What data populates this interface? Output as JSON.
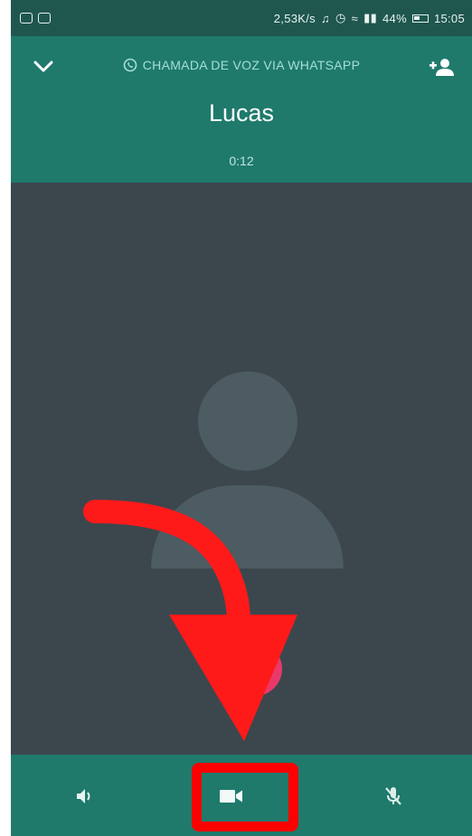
{
  "statusbar": {
    "speed": "2,53K/s",
    "battery": "44%",
    "time": "15:05"
  },
  "header": {
    "banner": "CHAMADA DE VOZ VIA WHATSAPP",
    "name": "Lucas",
    "timer": "0:12"
  },
  "controls": {
    "speaker_icon": "speaker-icon",
    "video_icon": "video-camera-icon",
    "mute_icon": "mic-off-icon"
  },
  "colors": {
    "header": "#1f7a6c",
    "statusbar": "#1f574f",
    "background": "#3b474d",
    "annotation": "#ff0000",
    "end_call": "#e8396a"
  }
}
